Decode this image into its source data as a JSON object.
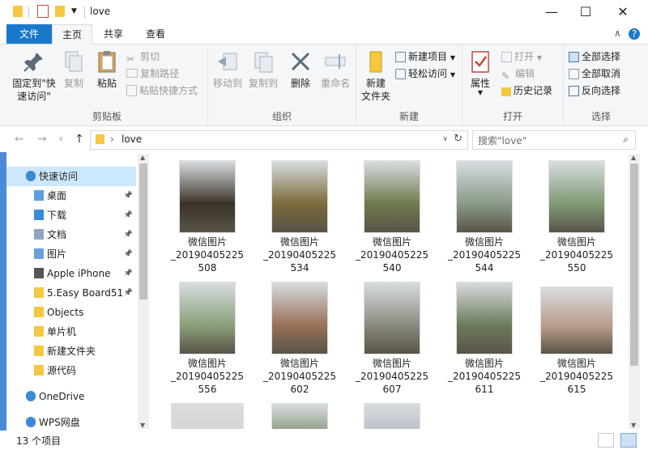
{
  "window": {
    "title": "love",
    "controls": {
      "minimize": "—",
      "maximize": "☐",
      "close": "✕"
    }
  },
  "ribbon_tabs": {
    "file": "文件",
    "home": "主页",
    "share": "共享",
    "view": "查看",
    "collapse": "∧",
    "help": "?"
  },
  "ribbon": {
    "clipboard": {
      "label": "剪贴板",
      "pin_quick": "固定到\"快速访问\"",
      "copy": "复制",
      "paste": "粘贴",
      "cut": "剪切",
      "copy_path": "复制路径",
      "paste_shortcut": "粘贴快捷方式"
    },
    "organize": {
      "label": "组织",
      "move_to": "移动到",
      "copy_to": "复制到",
      "delete": "删除",
      "rename": "重命名"
    },
    "new": {
      "label": "新建",
      "new_folder": "新建\n文件夹",
      "new_item": "新建项目",
      "easy_access": "轻松访问"
    },
    "open": {
      "label": "打开",
      "properties": "属性",
      "open": "打开",
      "edit": "编辑",
      "history": "历史记录"
    },
    "select": {
      "label": "选择",
      "select_all": "全部选择",
      "select_none": "全部取消",
      "invert": "反向选择"
    }
  },
  "address": {
    "separator": "›",
    "path": "love",
    "search_placeholder": "搜索\"love\""
  },
  "nav": {
    "items": [
      {
        "label": "快速访问",
        "pinned": false
      },
      {
        "label": "桌面",
        "pinned": true
      },
      {
        "label": "下载",
        "pinned": true
      },
      {
        "label": "文档",
        "pinned": true
      },
      {
        "label": "图片",
        "pinned": true
      },
      {
        "label": "Apple iPhone",
        "pinned": true
      },
      {
        "label": "5.Easy Board51",
        "pinned": true
      },
      {
        "label": "Objects",
        "pinned": false
      },
      {
        "label": "单片机",
        "pinned": false
      },
      {
        "label": "新建文件夹",
        "pinned": false
      },
      {
        "label": "源代码",
        "pinned": false
      },
      {
        "label": "OneDrive",
        "pinned": false
      },
      {
        "label": "WPS网盘",
        "pinned": false
      }
    ]
  },
  "files": {
    "name_prefix": "微信图片",
    "items": [
      {
        "line2": "_20190405225",
        "line3": "508",
        "color": "#3a3228"
      },
      {
        "line2": "_20190405225",
        "line3": "534",
        "color": "#7a6a3a"
      },
      {
        "line2": "_20190405225",
        "line3": "540",
        "color": "#6f7a4e"
      },
      {
        "line2": "_20190405225",
        "line3": "544",
        "color": "#8a9a88"
      },
      {
        "line2": "_20190405225",
        "line3": "550",
        "color": "#7f9a74"
      },
      {
        "line2": "_20190405225",
        "line3": "556",
        "color": "#8aa07a"
      },
      {
        "line2": "_20190405225",
        "line3": "602",
        "color": "#9a7058"
      },
      {
        "line2": "_20190405225",
        "line3": "607",
        "color": "#8a8a80"
      },
      {
        "line2": "_20190405225",
        "line3": "611",
        "color": "#6c7a5a"
      },
      {
        "line2": "_20190405225",
        "line3": "615",
        "color": "#b89a88"
      },
      {
        "line2": "",
        "line3": "",
        "color": "#d8d0c8"
      },
      {
        "line2": "",
        "line3": "",
        "color": "#6a7a5a"
      },
      {
        "line2": "",
        "line3": "",
        "color": "#a8b0b8"
      }
    ]
  },
  "status": {
    "count": "13 个项目"
  },
  "colors": {
    "accent": "#1979ca",
    "folder": "#f5c842"
  }
}
